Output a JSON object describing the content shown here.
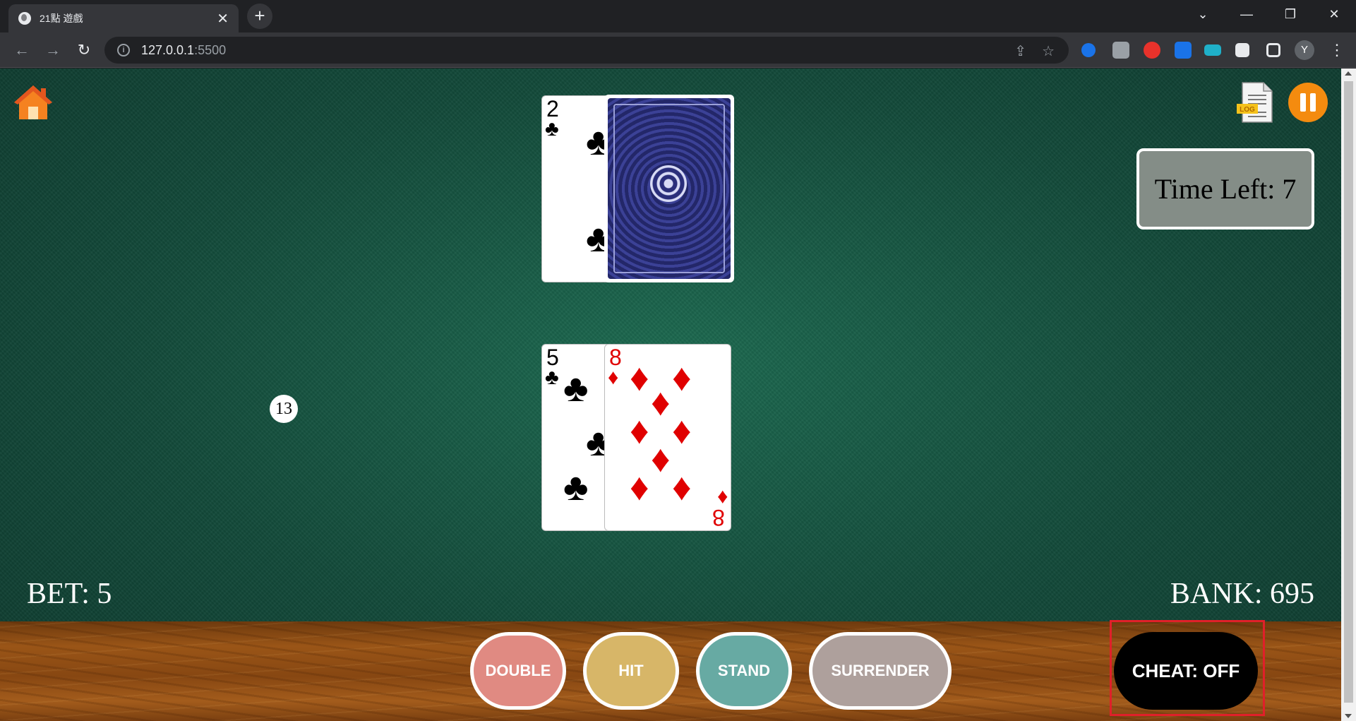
{
  "browser": {
    "tab_title": "21點 遊戲",
    "tab_close": "✕",
    "new_tab": "+",
    "url_host": "127.0.0.1",
    "url_port": ":5500",
    "profile_initial": "Y",
    "win_minimize": "—",
    "win_restore": "❐",
    "win_close": "✕",
    "chevron": "⌄"
  },
  "game": {
    "timer_text": "Time Left: 7",
    "score": "13",
    "bet_text": "BET: 5",
    "bank_text": "BANK: 695",
    "dealer": {
      "card1": {
        "rank": "2",
        "suit": "♣"
      },
      "card2": "face-down"
    },
    "player": {
      "card1": {
        "rank": "5",
        "suit": "♣"
      },
      "card2": {
        "rank": "8",
        "suit": "♦"
      }
    },
    "buttons": {
      "double": "DOUBLE",
      "hit": "HIT",
      "stand": "STAND",
      "surrender": "SURRENDER",
      "cheat": "CHEAT: OFF"
    },
    "icons": {
      "home": "home-icon",
      "log": "log-icon",
      "pause": "pause-icon",
      "log_label": "LOG"
    }
  }
}
